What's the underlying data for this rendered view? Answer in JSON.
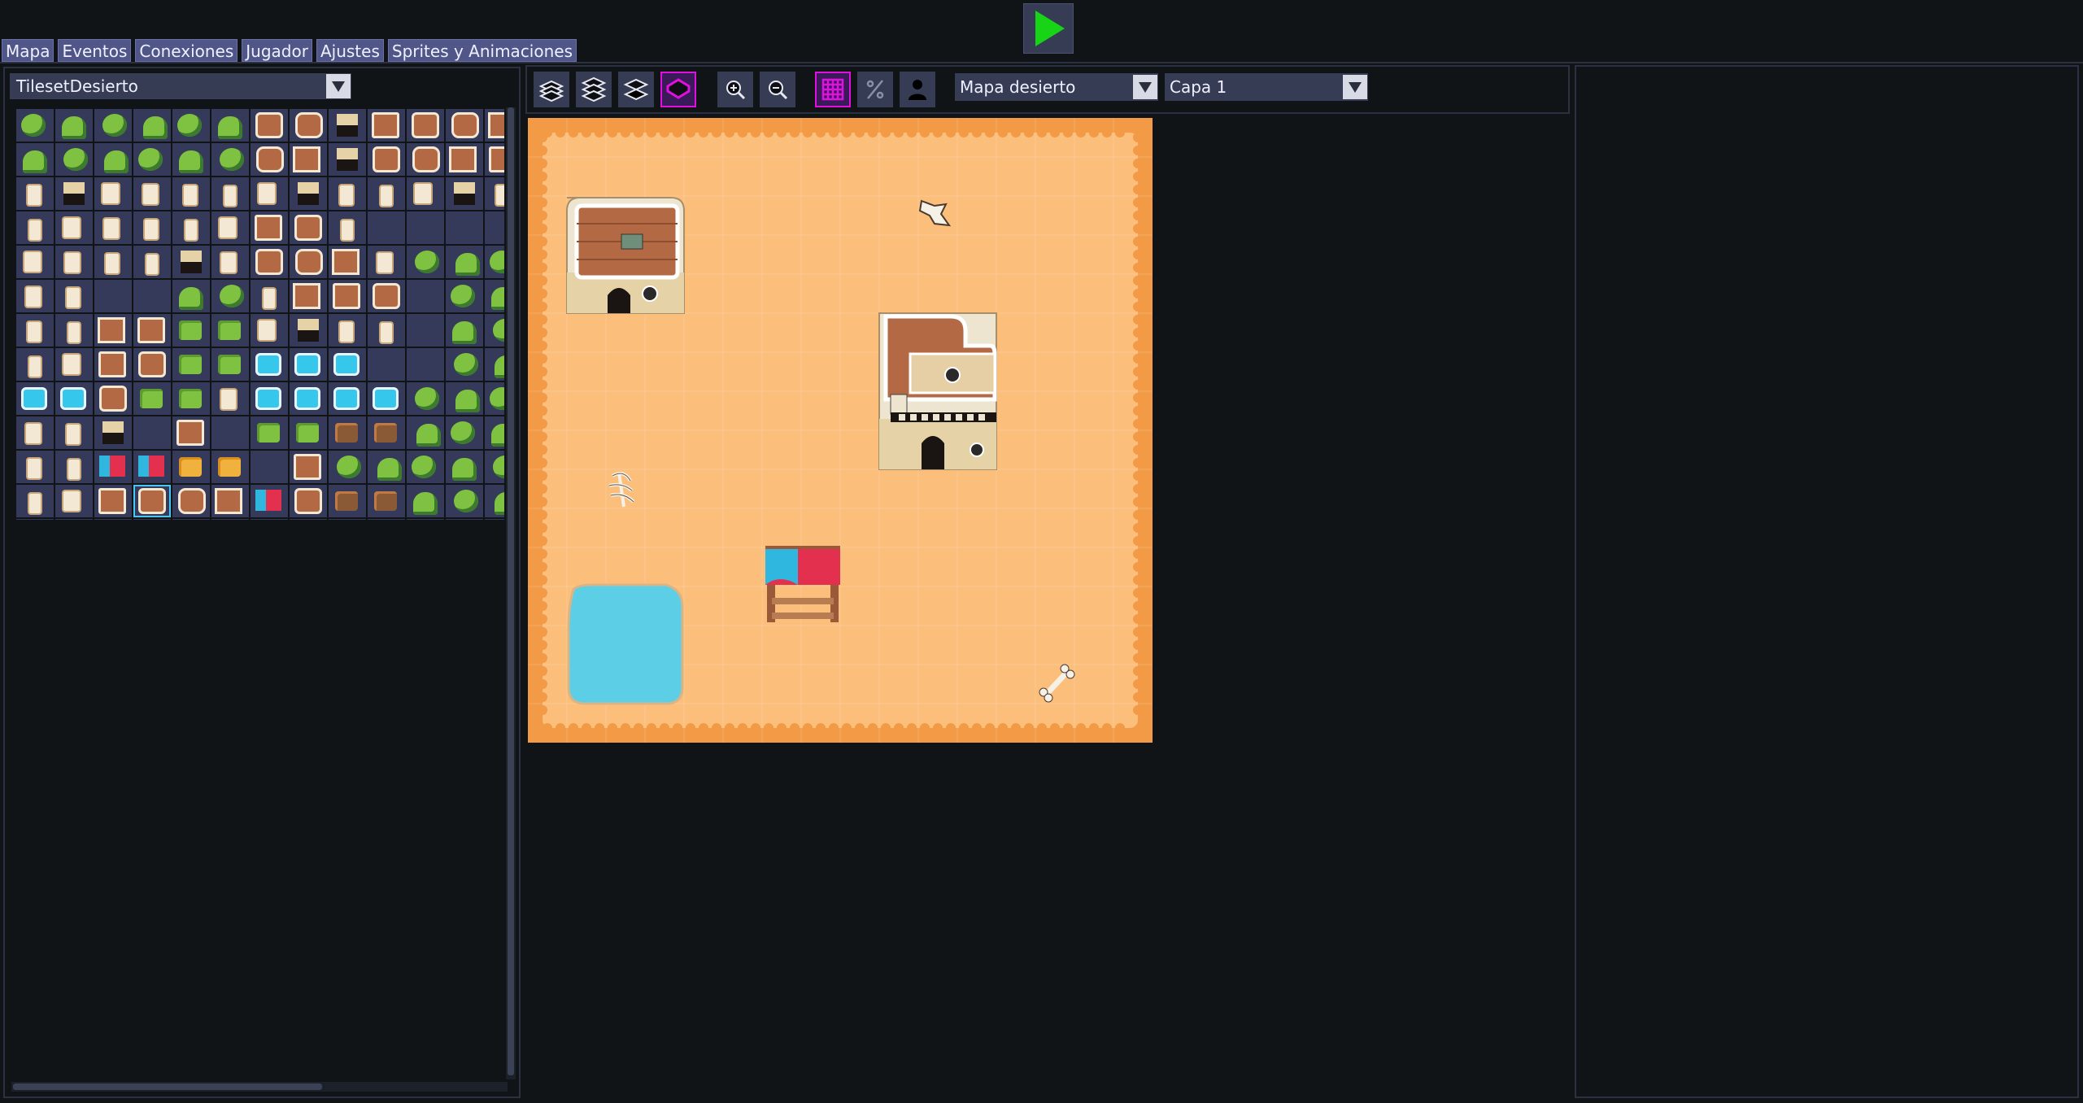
{
  "topbar": {
    "play_button": {
      "icon": "play-icon",
      "color": "#17d417"
    }
  },
  "tabs": [
    {
      "label": "Mapa"
    },
    {
      "label": "Eventos"
    },
    {
      "label": "Conexiones"
    },
    {
      "label": "Jugador"
    },
    {
      "label": "Ajustes"
    },
    {
      "label": "Sprites y Animaciones"
    }
  ],
  "tileset_panel": {
    "selected_tileset": "TilesetDesierto",
    "columns": 13,
    "rows": 13
  },
  "toolbar": {
    "buttons": [
      {
        "name": "layers-all-icon"
      },
      {
        "name": "layers-middle-icon"
      },
      {
        "name": "layer-single-icon"
      },
      {
        "name": "layer-highlight-icon",
        "active": true
      },
      {
        "name": "zoom-in-icon"
      },
      {
        "name": "zoom-out-icon"
      },
      {
        "name": "grid-icon",
        "active": true
      },
      {
        "name": "collision-percent-icon"
      },
      {
        "name": "player-icon"
      }
    ],
    "map_select": "Mapa desierto",
    "layer_select": "Capa 1"
  },
  "map": {
    "name": "Mapa desierto",
    "grid_cols": 16,
    "grid_rows": 16,
    "sand_color": "#fbbf7b",
    "border_color": "#f29a45"
  },
  "colors": {
    "background": "#111417",
    "panel_border": "#2b3140",
    "tab_bg": "#505688",
    "button_bg": "#353c54",
    "active_accent": "#e010e0",
    "tile_empty": "#35395a"
  }
}
